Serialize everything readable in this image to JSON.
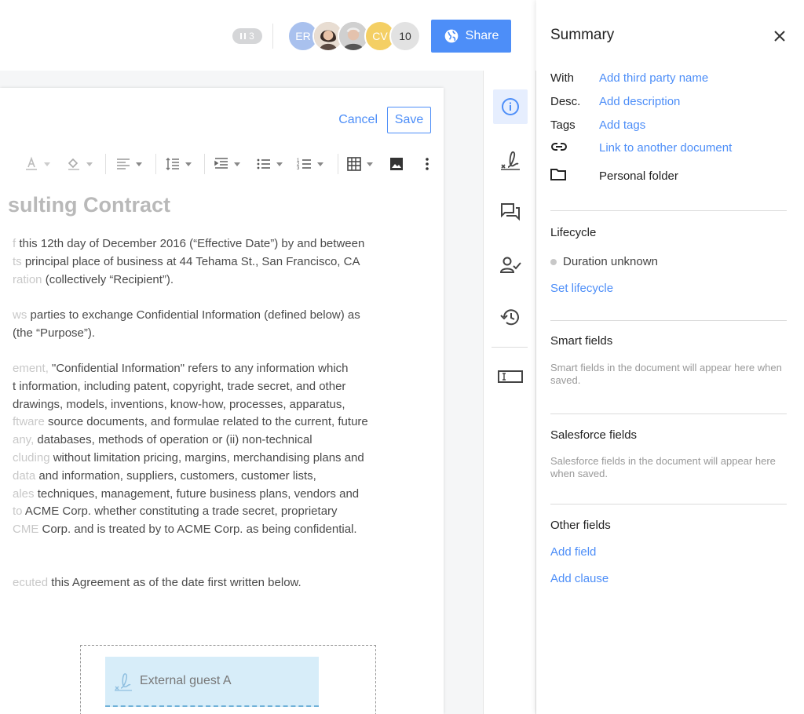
{
  "topbar": {
    "presence_count": "3",
    "avatars": [
      {
        "initials": "ER",
        "color": "#a9c1ee"
      },
      {
        "initials": "",
        "color": "#c9b8a8"
      },
      {
        "initials": "",
        "color": "#b9b9b9"
      },
      {
        "initials": "CV",
        "color": "#f4cf64"
      }
    ],
    "avatar_more": "10",
    "share_label": "Share"
  },
  "editor": {
    "cancel_label": "Cancel",
    "save_label": "Save",
    "title": "sulting Contract",
    "paragraphs": [
      {
        "lines": [
          {
            "faded": "f",
            "text": " this 12th day of December 2016 (“Effective Date”) by and between"
          },
          {
            "faded": "ts",
            "text": " principal place of business at 44 Tehama St., San Francisco, CA"
          },
          {
            "faded": "ration",
            "text": " (collectively “Recipient”)."
          }
        ]
      },
      {
        "lines": [
          {
            "faded": "ws",
            "text": " parties to exchange Confidential Information (defined below) as"
          },
          {
            "faded": "",
            "text": "(the “Purpose”)."
          }
        ]
      },
      {
        "lines": [
          {
            "faded": "ement,",
            "text": " \"Confidential Information\" refers to any information which"
          },
          {
            "faded": "",
            "text": "t information, including patent, copyright, trade secret, and other"
          },
          {
            "faded": "",
            "text": " drawings, models, inventions, know-how, processes, apparatus,"
          },
          {
            "faded": "ftware",
            "text": " source documents, and formulae related to the current, future"
          },
          {
            "faded": "any,",
            "text": " databases, methods of operation or (ii) non-technical"
          },
          {
            "faded": "cluding",
            "text": " without limitation pricing, margins, merchandising plans and"
          },
          {
            "faded": "data",
            "text": " and information, suppliers, customers, customer lists,"
          },
          {
            "faded": "ales",
            "text": " techniques, management, future business plans, vendors and"
          },
          {
            "faded": "to",
            "text": " ACME Corp. whether constituting a trade secret, proprietary"
          },
          {
            "faded": "CME",
            "text": " Corp. and is treated by to ACME Corp. as being confidential."
          }
        ]
      },
      {
        "lines": [
          {
            "faded": "ecuted",
            "text": " this Agreement as of the date first written below."
          }
        ]
      }
    ],
    "signature_field": "External guest A"
  },
  "rail": {
    "items": [
      "info-icon",
      "signature-icon",
      "comments-icon",
      "approvals-icon",
      "history-icon",
      "text-field-icon"
    ],
    "accent": "#4d8ef8"
  },
  "summary": {
    "title": "Summary",
    "with_label": "With",
    "with_value": "Add third party name",
    "desc_label": "Desc.",
    "desc_value": "Add description",
    "tags_label": "Tags",
    "tags_value": "Add tags",
    "link_value": "Link to another document",
    "folder_value": "Personal folder",
    "lifecycle_title": "Lifecycle",
    "lifecycle_status": "Duration unknown",
    "lifecycle_link": "Set lifecycle",
    "smart_title": "Smart fields",
    "smart_hint": "Smart fields in the document will appear here when saved.",
    "salesforce_title": "Salesforce fields",
    "salesforce_hint": "Salesforce fields in the document will appear here when saved.",
    "other_title": "Other fields",
    "add_field": "Add field",
    "add_clause": "Add clause"
  }
}
